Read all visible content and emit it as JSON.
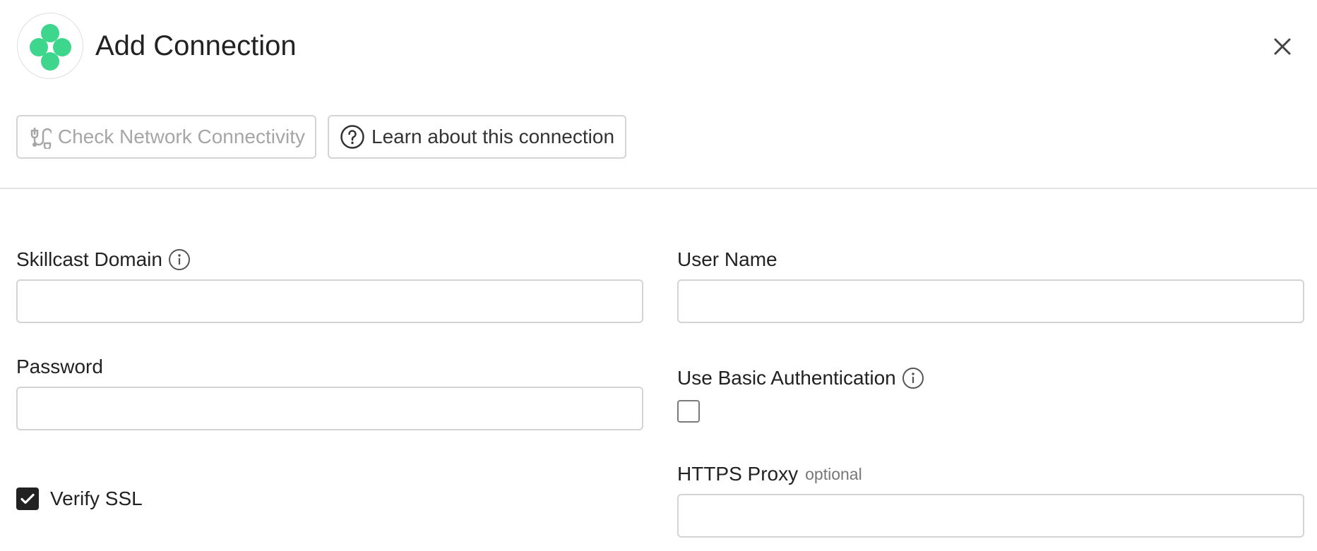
{
  "header": {
    "logo_icon": "connector-logo-icon",
    "title": "Add Connection",
    "close_icon": "close-icon"
  },
  "toolbar": {
    "check_network_label": "Check Network Connectivity",
    "check_network_icon": "network-plug-icon",
    "learn_label": "Learn about this connection",
    "learn_icon": "help-circle-icon"
  },
  "form": {
    "skillcast_domain": {
      "label": "Skillcast Domain",
      "value": "",
      "info_icon": "info-icon"
    },
    "user_name": {
      "label": "User Name",
      "value": ""
    },
    "password": {
      "label": "Password",
      "value": ""
    },
    "use_basic_auth": {
      "label": "Use Basic Authentication",
      "checked": false,
      "info_icon": "info-icon"
    },
    "verify_ssl": {
      "label": "Verify SSL",
      "checked": true
    },
    "https_proxy": {
      "label": "HTTPS Proxy",
      "optional_tag": "optional",
      "value": ""
    }
  },
  "colors": {
    "logo_green": "#3dd68c",
    "border": "#d4d4d4",
    "disabled_text": "#a6a6a6",
    "checkbox_checked": "#222222"
  }
}
